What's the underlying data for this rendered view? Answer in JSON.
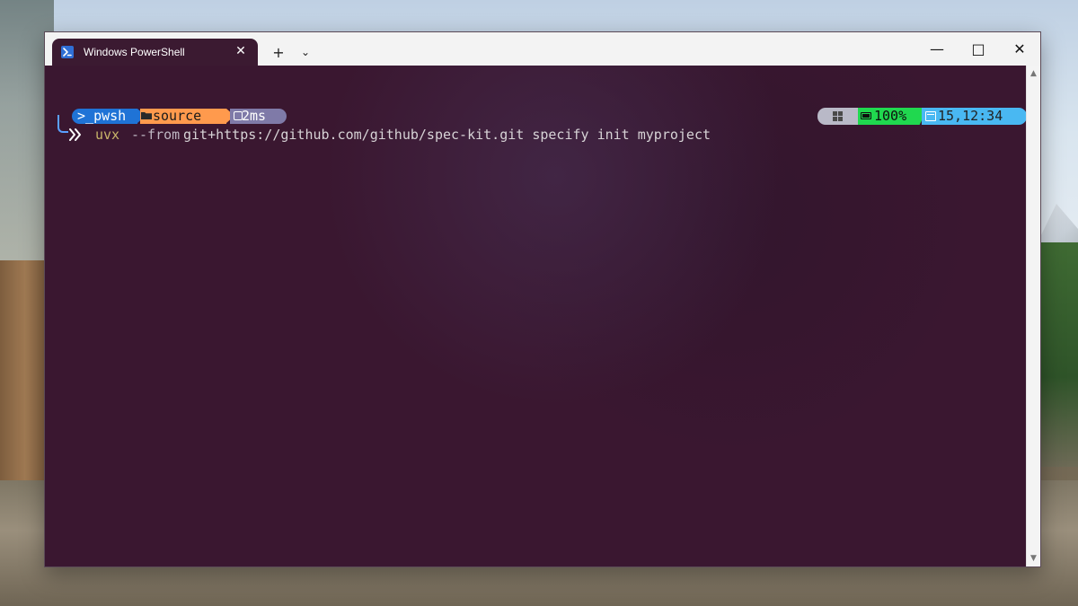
{
  "window": {
    "title": "Windows PowerShell",
    "controls": {
      "minimize": "—",
      "maximize": "□",
      "close": "✕"
    },
    "tab_actions": {
      "new_tab": "+",
      "dropdown": "⌄"
    }
  },
  "terminal": {
    "prompt_left": {
      "shell": "pwsh",
      "shell_prefix": ">_",
      "folder": "source",
      "duration": "2ms"
    },
    "status_right": {
      "battery": "100%",
      "datetime": "15,12:34"
    },
    "command": {
      "executable": "uvx",
      "flag": "--from",
      "rest": "git+https://github.com/github/spec-kit.git specify init myproject"
    }
  },
  "colors": {
    "terminal_bg": "#3a1730",
    "pwsh_segment": "#1f73d6",
    "folder_segment": "#ff9a4d",
    "duration_segment": "#7f7aa8",
    "os_segment": "#b9b9c7",
    "battery_segment": "#20d84f",
    "datetime_segment": "#49b8f2"
  },
  "icons": {
    "tab_icon": "powershell-icon",
    "folder_icon": "folder-icon",
    "duration_icon": "clock-icon",
    "os_icon": "windows-icon",
    "battery_icon": "battery-icon",
    "calendar_icon": "calendar-icon",
    "prompt_icon": "chevron-right-icon"
  }
}
